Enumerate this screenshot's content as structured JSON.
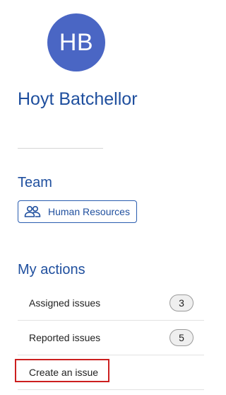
{
  "user": {
    "initials": "HB",
    "name": "Hoyt Batchellor",
    "avatar_color": "#4a66c4"
  },
  "team": {
    "title": "Team",
    "chip_label": "Human Resources",
    "chip_icon": "people-icon"
  },
  "actions": {
    "title": "My actions",
    "items": [
      {
        "label": "Assigned issues",
        "count": "3"
      },
      {
        "label": "Reported issues",
        "count": "5"
      },
      {
        "label": "Create an issue"
      }
    ]
  },
  "colors": {
    "accent": "#1f4f9e",
    "highlight": "#cc1f1f"
  }
}
